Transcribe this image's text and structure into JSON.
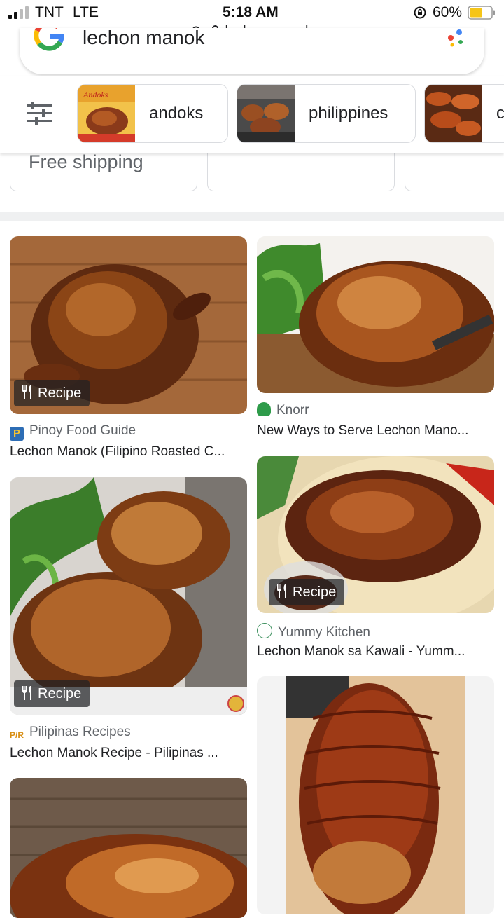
{
  "status_bar": {
    "carrier": "TNT",
    "network": "LTE",
    "time": "5:18 AM",
    "battery_percent": "60%",
    "battery_level": 0.6
  },
  "browser": {
    "url": "lechon manok"
  },
  "search": {
    "query": "lechon manok"
  },
  "chips": [
    {
      "label": "andoks"
    },
    {
      "label": "philippines"
    },
    {
      "label": "c"
    }
  ],
  "filters": [
    {
      "label": "Free shipping"
    },
    {
      "label": ""
    },
    {
      "label": ""
    }
  ],
  "results": [
    {
      "source": "Pinoy Food Guide",
      "title": "Lechon Manok (Filipino Roasted C...",
      "badge": "Recipe",
      "favicon_color": "#2d6db5",
      "favicon_text": "P"
    },
    {
      "source": "Knorr",
      "title": "New Ways to Serve Lechon Mano...",
      "badge": "",
      "favicon_color": "#2e9b4a",
      "favicon_text": ""
    },
    {
      "source": "Pilipinas Recipes",
      "title": "Lechon Manok Recipe - Pilipinas ...",
      "badge": "Recipe",
      "favicon_color": "#e6a11e",
      "favicon_text": "P/R"
    },
    {
      "source": "Yummy Kitchen",
      "title": "Lechon Manok sa Kawali - Yumm...",
      "badge": "Recipe",
      "favicon_color": "#3a8f5c",
      "favicon_text": ""
    }
  ],
  "colors": {
    "battery_fill": "#f5c518",
    "chip_border": "#dadce0",
    "divider": "#eff0f1"
  },
  "icons": [
    "signal-icon",
    "battery-icon",
    "orientation-lock-icon",
    "padlock-icon",
    "google-logo-icon",
    "lens-icon",
    "filter-sliders-icon",
    "recipe-utensils-icon"
  ]
}
